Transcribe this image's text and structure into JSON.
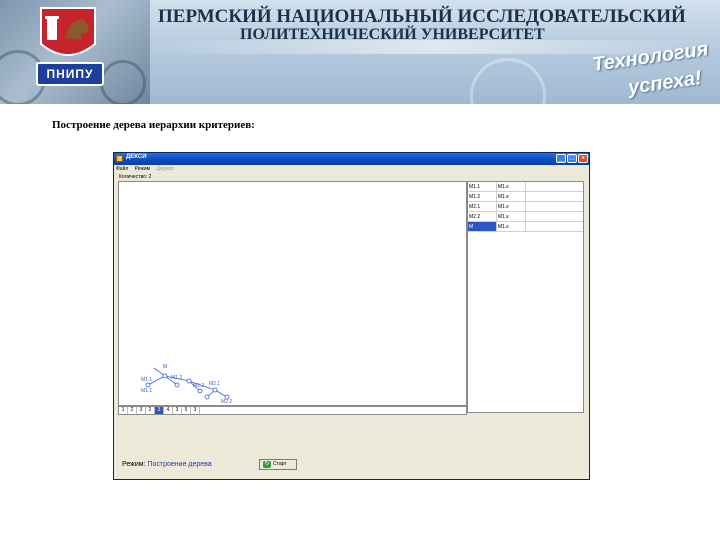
{
  "banner": {
    "university_line1": "ПЕРМСКИЙ НАЦИОНАЛЬНЫЙ ИССЛЕДОВАТЕЛЬСКИЙ",
    "university_line2": "ПОЛИТЕХНИЧЕСКИЙ УНИВЕРСИТЕТ",
    "logo_text": "ПНИПУ",
    "slogan_line1": "Технология",
    "slogan_line2": "успеха!"
  },
  "caption": "Построение дерева иерархии критериев:",
  "window": {
    "title": "ДЕКСИ",
    "title_buttons": [
      "_",
      "□",
      "×"
    ],
    "menu": [
      {
        "label": "Файл",
        "enabled": true
      },
      {
        "label": "Режим",
        "enabled": true
      },
      {
        "label": "Дерево",
        "enabled": false
      }
    ],
    "toolbar_label": "Количество: 2",
    "tree": {
      "nodes": [
        {
          "id": "root",
          "label": "М"
        },
        {
          "id": "n1",
          "label": "М1.1"
        },
        {
          "id": "n2",
          "label": "М1.2"
        },
        {
          "id": "n11",
          "label": "М1.1"
        },
        {
          "id": "n12",
          "label": "М1.2"
        },
        {
          "id": "n21",
          "label": "М2.1"
        },
        {
          "id": "n22",
          "label": "М2.2"
        }
      ]
    },
    "levels": [
      "1",
      "2",
      "3",
      "2",
      "3",
      "4",
      "3",
      "5",
      "3"
    ],
    "levels_selected_index": 4,
    "table": {
      "rows": [
        {
          "c1": "М1.1",
          "c2": "М1.к",
          "c3": ""
        },
        {
          "c1": "М1.2",
          "c2": "М1.к",
          "c3": ""
        },
        {
          "c1": "М2.1",
          "c2": "М1.к",
          "c3": ""
        },
        {
          "c1": "М2.2",
          "c2": "М1.к",
          "c3": ""
        },
        {
          "c1": "М",
          "c2": "М1.к",
          "c3": ""
        }
      ],
      "selected_row": 4
    },
    "status_label": "Режим:",
    "status_value": "Построение дерева",
    "start_button_label": "Старт",
    "start_icon": "refresh-icon"
  },
  "colors": {
    "titlebar": "#0a4fc6",
    "selection": "#2b57c4",
    "window_bg": "#ece9d8",
    "tree_stroke": "#3a5fcd"
  }
}
